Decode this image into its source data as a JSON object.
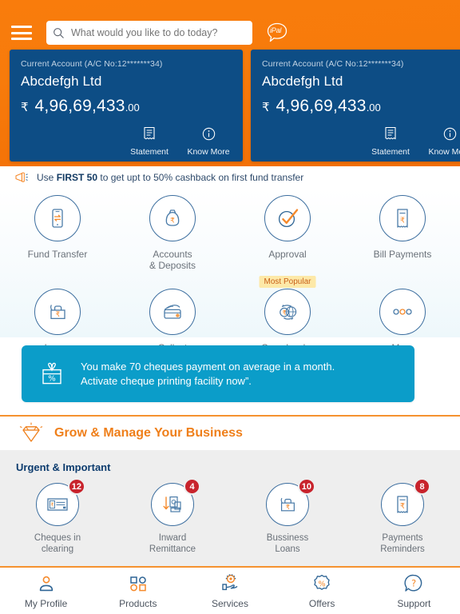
{
  "header": {
    "menu_icon": "hamburger-icon",
    "search": {
      "placeholder": "What would you like to do today?",
      "value": "",
      "icon": "search-icon"
    },
    "assistant": {
      "label": "iPal",
      "icon": "chat-bubble-icon"
    },
    "background_color": "#f77b0b"
  },
  "accounts": [
    {
      "sub_title": "Current Account (A/C No:12*******34)",
      "name": "Abcdefgh Ltd",
      "currency_symbol": "₹",
      "balance_main": "4,96,69,433",
      "balance_decimals": ".00",
      "actions": [
        {
          "label": "Statement",
          "icon": "statement-icon"
        },
        {
          "label": "Know More",
          "icon": "info-icon"
        }
      ],
      "card_color": "#0d4d85"
    },
    {
      "sub_title": "Current Account (A/C No:12*******34)",
      "name": "Abcdefgh Ltd",
      "currency_symbol": "₹",
      "balance_main": "4,96,69,433",
      "balance_decimals": ".00",
      "actions": [
        {
          "label": "Statement",
          "icon": "statement-icon"
        },
        {
          "label": "Know More",
          "icon": "info-icon"
        }
      ],
      "card_color": "#0d4d85"
    }
  ],
  "promo": {
    "icon": "megaphone-icon",
    "prefix": "Use ",
    "code": "FIRST 50",
    "suffix": " to get upt to 50% cashback on first fund transfer"
  },
  "quick_actions": {
    "row1": [
      {
        "label": "Fund Transfer",
        "icon": "mobile-transfer-icon",
        "badge": ""
      },
      {
        "label": "Accounts\n& Deposits",
        "label_line1": "Accounts",
        "label_line2": "& Deposits",
        "icon": "money-bag-icon",
        "badge": ""
      },
      {
        "label": "Approval",
        "icon": "check-circle-icon",
        "badge": ""
      },
      {
        "label": "Bill Payments",
        "icon": "bill-rupee-icon",
        "badge": ""
      }
    ],
    "row2": [
      {
        "label": "Loans",
        "icon": "briefcase-rupee-icon",
        "badge": ""
      },
      {
        "label": "Collect",
        "icon": "wallet-icon",
        "badge": ""
      },
      {
        "label": "Crossborder",
        "icon": "globe-exchange-icon",
        "badge": "Most Popular"
      },
      {
        "label": "More",
        "icon": "three-dots-icon",
        "badge": ""
      }
    ]
  },
  "cheque_banner": {
    "icon": "gift-percent-icon",
    "line1": "You make 70 cheques payment on average in a month.",
    "line2": "Activate cheque printing facility now”.",
    "background_color": "#0b9dc9"
  },
  "grow_section": {
    "icon": "diamond-icon",
    "title": "Grow & Manage Your Business",
    "title_color": "#ef7f1a",
    "urgent_title": "Urgent & Important",
    "items": [
      {
        "label_line1": "Cheques in",
        "label_line2": "clearing",
        "badge": "12",
        "icon": "cheque-icon"
      },
      {
        "label_line1": "Inward",
        "label_line2": "Remittance",
        "badge": "4",
        "icon": "inward-remittance-icon"
      },
      {
        "label_line1": "Bussiness",
        "label_line2": "Loans",
        "badge": "10",
        "icon": "briefcase-rupee-icon"
      },
      {
        "label_line1": "Payments",
        "label_line2": "Reminders",
        "badge": "8",
        "icon": "receipt-rupee-icon"
      }
    ],
    "badge_color": "#c8232c"
  },
  "bottom_nav": [
    {
      "label": "My Profile",
      "icon": "user-icon"
    },
    {
      "label": "Products",
      "icon": "grid-icon"
    },
    {
      "label": "Services",
      "icon": "headset-hand-icon"
    },
    {
      "label": "Offers",
      "icon": "percent-badge-icon"
    },
    {
      "label": "Support",
      "icon": "question-bubble-icon"
    }
  ]
}
